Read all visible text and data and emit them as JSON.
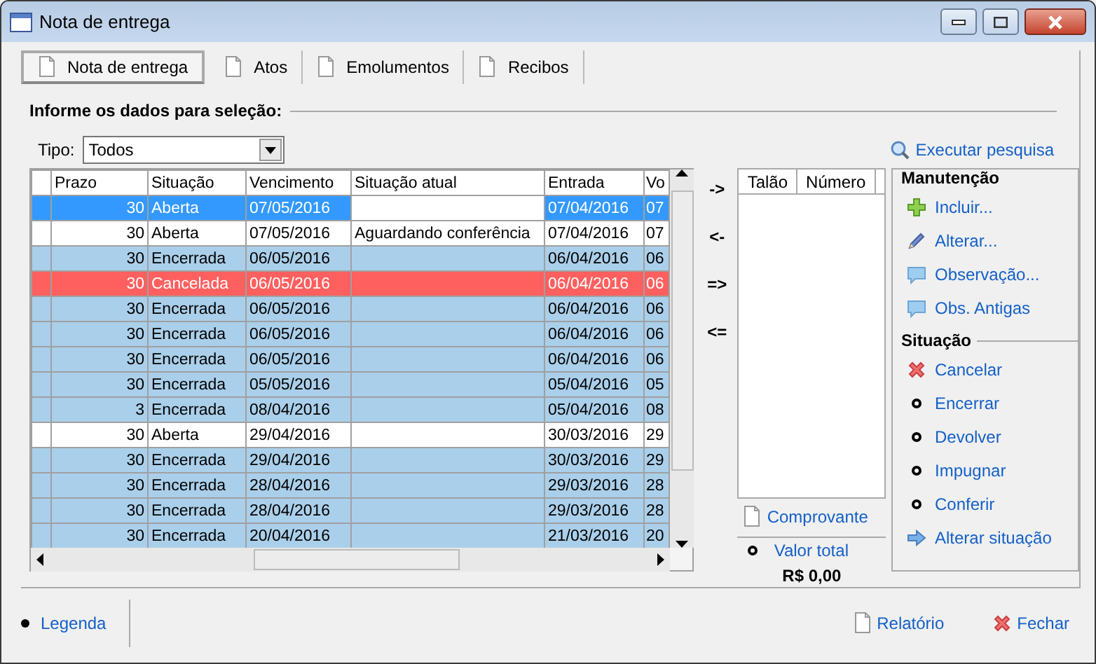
{
  "window": {
    "title": "Nota de entrega"
  },
  "tabs": [
    {
      "label": "Nota de entrega",
      "selected": true
    },
    {
      "label": "Atos",
      "selected": false
    },
    {
      "label": "Emolumentos",
      "selected": false
    },
    {
      "label": "Recibos",
      "selected": false
    }
  ],
  "section_title": "Informe os dados para seleção:",
  "filter": {
    "label": "Tipo:",
    "value": "Todos"
  },
  "search_link": "Executar pesquisa",
  "table": {
    "columns": [
      "Prazo",
      "Situação",
      "Vencimento",
      "Situação atual",
      "Entrada",
      "Vo"
    ],
    "rows": [
      {
        "selected": true,
        "color": "#ffffff",
        "prazo": "30",
        "situacao": "Aberta",
        "vencimento": "07/05/2016",
        "entrada": "07/04/2016",
        "vo": "07"
      },
      {
        "selected": false,
        "color": "#ffffff",
        "prazo": "30",
        "situacao": "Aberta",
        "vencimento": "07/05/2016",
        "situacao_atual": "Aguardando conferência",
        "entrada": "07/04/2016",
        "vo": "07"
      },
      {
        "selected": false,
        "color": "#aacfea",
        "prazo": "30",
        "situacao": "Encerrada",
        "vencimento": "06/05/2016",
        "entrada": "06/04/2016",
        "vo": "06"
      },
      {
        "selected": false,
        "color": "#fe5f5f",
        "prazo": "30",
        "situacao": "Cancelada",
        "vencimento": "06/05/2016",
        "entrada": "06/04/2016",
        "vo": "06"
      },
      {
        "selected": false,
        "color": "#aacfea",
        "prazo": "30",
        "situacao": "Encerrada",
        "vencimento": "06/05/2016",
        "entrada": "06/04/2016",
        "vo": "06"
      },
      {
        "selected": false,
        "color": "#aacfea",
        "prazo": "30",
        "situacao": "Encerrada",
        "vencimento": "06/05/2016",
        "entrada": "06/04/2016",
        "vo": "06"
      },
      {
        "selected": false,
        "color": "#aacfea",
        "prazo": "30",
        "situacao": "Encerrada",
        "vencimento": "06/05/2016",
        "entrada": "06/04/2016",
        "vo": "06"
      },
      {
        "selected": false,
        "color": "#aacfea",
        "prazo": "30",
        "situacao": "Encerrada",
        "vencimento": "05/05/2016",
        "entrada": "05/04/2016",
        "vo": "05"
      },
      {
        "selected": false,
        "color": "#aacfea",
        "prazo": "3",
        "situacao": "Encerrada",
        "vencimento": "08/04/2016",
        "entrada": "05/04/2016",
        "vo": "08"
      },
      {
        "selected": false,
        "color": "#ffffff",
        "prazo": "30",
        "situacao": "Aberta",
        "vencimento": "29/04/2016",
        "entrada": "30/03/2016",
        "vo": "29"
      },
      {
        "selected": false,
        "color": "#aacfea",
        "prazo": "30",
        "situacao": "Encerrada",
        "vencimento": "29/04/2016",
        "entrada": "30/03/2016",
        "vo": "29"
      },
      {
        "selected": false,
        "color": "#aacfea",
        "prazo": "30",
        "situacao": "Encerrada",
        "vencimento": "28/04/2016",
        "entrada": "29/03/2016",
        "vo": "28"
      },
      {
        "selected": false,
        "color": "#aacfea",
        "prazo": "30",
        "situacao": "Encerrada",
        "vencimento": "28/04/2016",
        "entrada": "29/03/2016",
        "vo": "28"
      },
      {
        "selected": false,
        "color": "#aacfea",
        "prazo": "30",
        "situacao": "Encerrada",
        "vencimento": "20/04/2016",
        "entrada": "21/03/2016",
        "vo": "20"
      }
    ]
  },
  "transfer_buttons": [
    "->",
    "<-",
    "=>",
    "<="
  ],
  "talao_list": {
    "columns": [
      "Talão",
      "Número"
    ]
  },
  "comprovante_link": "Comprovante",
  "total": {
    "label": "Valor total",
    "value": "R$ 0,00"
  },
  "groups": [
    {
      "title": "Manutenção",
      "actions": [
        {
          "kind": "plus",
          "label": "Incluir..."
        },
        {
          "kind": "pencil",
          "label": "Alterar..."
        },
        {
          "kind": "comment",
          "label": "Observação..."
        },
        {
          "kind": "comment",
          "label": "Obs. Antigas"
        }
      ]
    },
    {
      "title": "Situação",
      "actions": [
        {
          "kind": "cross",
          "label": "Cancelar"
        },
        {
          "kind": "dot",
          "label": "Encerrar"
        },
        {
          "kind": "dot",
          "label": "Devolver"
        },
        {
          "kind": "dot",
          "label": "Impugnar"
        },
        {
          "kind": "dot",
          "label": "Conferir"
        },
        {
          "kind": "arrow",
          "label": "Alterar situação"
        }
      ]
    }
  ],
  "footer": {
    "legend_link": "Legenda",
    "report_link": "Relatório",
    "close_link": "Fechar"
  }
}
